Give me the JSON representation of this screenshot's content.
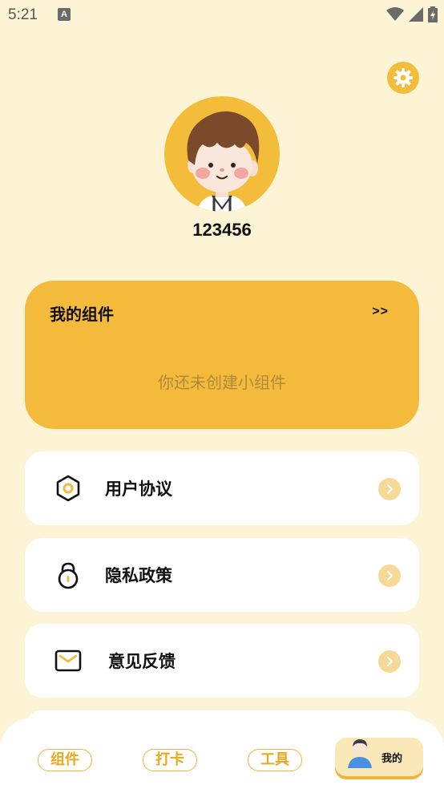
{
  "status_bar": {
    "time": "5:21",
    "notification_letter": "A"
  },
  "profile": {
    "username": "123456"
  },
  "widget_card": {
    "title": "我的组件",
    "more": ">>",
    "empty_text": "你还未创建小组件"
  },
  "menu": [
    {
      "label": "用户协议",
      "icon": "hexagon-icon"
    },
    {
      "label": "隐私政策",
      "icon": "lock-icon"
    },
    {
      "label": "意见反馈",
      "icon": "envelope-icon"
    }
  ],
  "tabs": [
    {
      "label": "组件"
    },
    {
      "label": "打卡"
    },
    {
      "label": "工具"
    },
    {
      "label": "我的",
      "active": true
    }
  ],
  "colors": {
    "background": "#FDF3D5",
    "accent": "#F3BA3C",
    "card": "#FFFFFF",
    "arrow_bg": "#F7D997"
  }
}
